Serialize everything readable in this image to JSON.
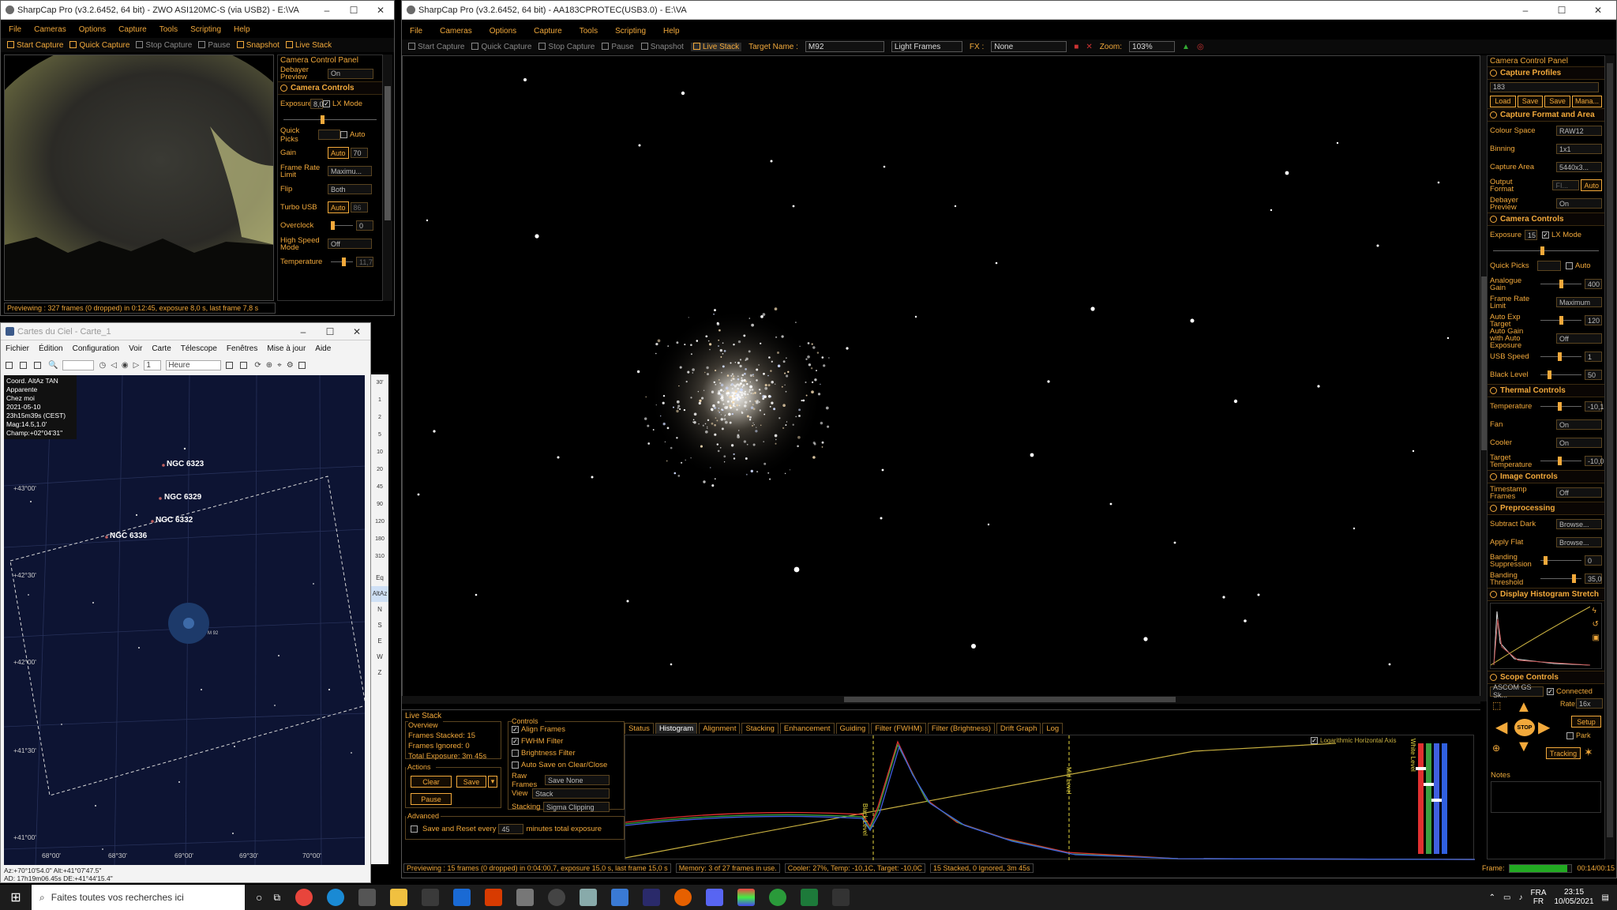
{
  "colors": {
    "accent": "#f2a93b",
    "sky": "#0d1433",
    "stars_bg": "#000000",
    "hist_red": "#e03030",
    "hist_green": "#3aa040",
    "hist_blue": "#4060e0",
    "hist_curve": "#c8b040"
  },
  "cam1": {
    "title": "SharpCap Pro (v3.2.6452, 64 bit) - ZWO ASI120MC-S (via USB2) - E:\\VA",
    "menu": [
      "File",
      "Cameras",
      "Options",
      "Capture",
      "Tools",
      "Scripting",
      "Help"
    ],
    "toolbar": [
      "Start Capture",
      "Quick Capture",
      "Stop Capture",
      "Pause",
      "Snapshot",
      "Live Stack"
    ],
    "panel_title": "Camera Control Panel",
    "debayer_label": "Debayer Preview",
    "debayer_value": "On",
    "controls_title": "Camera Controls",
    "exposure_label": "Exposure",
    "exposure_value": "8,0",
    "lx_label": "LX Mode",
    "quick_picks": "Quick Picks",
    "auto": "Auto",
    "rows": [
      {
        "label": "Gain",
        "value": "70",
        "auto": "Auto"
      },
      {
        "label": "Frame Rate Limit",
        "value": "Maximu..."
      },
      {
        "label": "Flip",
        "value": "Both"
      },
      {
        "label": "Turbo USB",
        "value": "86",
        "auto": "Auto"
      },
      {
        "label": "Overclock",
        "value": "0"
      },
      {
        "label": "High Speed Mode",
        "value": "Off"
      },
      {
        "label": "Temperature",
        "value": "11,7"
      }
    ],
    "status": "Previewing : 327 frames (0 dropped) in 0:12:45, exposure 8,0 s, last frame 7,8 s"
  },
  "cdc": {
    "title": "Cartes du Ciel - Carte_1",
    "menu": [
      "Fichier",
      "Édition",
      "Configuration",
      "Voir",
      "Carte",
      "Télescope",
      "Fenêtres",
      "Mise à jour",
      "Aide"
    ],
    "time_unit": "Heure",
    "step": "1",
    "info": [
      "Coord. AltAz TAN",
      "Apparente",
      "Chez moi",
      "2021-05-10",
      "23h15m39s (CEST)",
      "Mag:14.5,1.0'",
      "Champ:+02°04'31\""
    ],
    "objects": [
      "NGC 6323",
      "NGC 6329",
      "NGC 6332",
      "NGC 6336",
      "M 92"
    ],
    "dec_labels": [
      "+43°00'",
      "+42°30'",
      "+42°00'",
      "+41°30'",
      "+41°00'"
    ],
    "ra_labels": [
      "68°00'",
      "68°30'",
      "69°00'",
      "69°30'",
      "70°00'"
    ],
    "zoom_scale": [
      "30'",
      "1",
      "2",
      "5",
      "10",
      "20",
      "45",
      "90",
      "120",
      "180",
      "310"
    ],
    "side_labels": [
      "Eq",
      "AltAz",
      "N",
      "S",
      "E",
      "W",
      "Z"
    ],
    "status1": "Az:+70°10'54.0\" Alt:+41°07'47.5\"",
    "status2": "AD: 17h19m06.45s DE:+41°44'15.4\""
  },
  "cam2": {
    "title": "SharpCap Pro (v3.2.6452, 64 bit) - AA183CPROTEC(USB3.0) - E:\\VA",
    "menu": [
      "File",
      "Cameras",
      "Options",
      "Capture",
      "Tools",
      "Scripting",
      "Help"
    ],
    "toolbar": [
      "Start Capture",
      "Quick Capture",
      "Stop Capture",
      "Pause",
      "Snapshot",
      "Live Stack"
    ],
    "target_label": "Target Name :",
    "target_value": "M92",
    "frames_value": "Light Frames",
    "fx_label": "FX :",
    "fx_value": "None",
    "zoom_label": "Zoom:",
    "zoom_value": "103%",
    "livestack": {
      "title": "Live Stack",
      "overview": "Overview",
      "stats": [
        "Frames Stacked: 15",
        "Frames Ignored: 0",
        "Total Exposure: 3m 45s"
      ],
      "controls_title": "Controls",
      "checks": [
        {
          "label": "Align Frames",
          "on": true
        },
        {
          "label": "FWHM Filter",
          "on": true
        },
        {
          "label": "Brightness Filter",
          "on": false
        },
        {
          "label": "Auto Save on Clear/Close",
          "on": false
        }
      ],
      "actions_title": "Actions",
      "clear": "Clear",
      "save": "Save",
      "pause": "Pause",
      "raw_label": "Raw Frames",
      "raw_value": "Save None",
      "view_label": "View",
      "view_value": "Stack",
      "stacking_label": "Stacking",
      "stacking_value": "Sigma Clipping",
      "advanced_title": "Advanced",
      "save_reset_label": "Save and Reset every",
      "save_reset_value": "45",
      "save_reset_unit": "minutes total exposure",
      "tabs": [
        "Status",
        "Histogram",
        "Alignment",
        "Stacking",
        "Enhancement",
        "Guiding",
        "Filter (FWHM)",
        "Filter (Brightness)",
        "Drift Graph",
        "Log"
      ],
      "active_tab": "Histogram",
      "log_axis": "Logarithmic Horizontal Axis",
      "black_level": "Black Level",
      "mid_level": "Mid Level",
      "white_level": "White Level"
    },
    "status": [
      "Previewing : 15 frames (0 dropped) in 0:04:00,7, exposure 15,0 s, last frame 15,0 s",
      "Memory: 3 of 27 frames in use.",
      "Cooler: 27%, Temp: -10,1C, Target: -10,0C",
      "15 Stacked, 0 Ignored, 3m 45s"
    ],
    "frame_label": "Frame:",
    "frame_time": "00:14/00:15"
  },
  "ccp": {
    "title": "Camera Control Panel",
    "profiles_title": "Capture Profiles",
    "profile_value": "183",
    "profile_buttons": [
      "Load",
      "Save",
      "Save",
      "Mana..."
    ],
    "format_title": "Capture Format and Area",
    "format_rows": [
      {
        "label": "Colour Space",
        "value": "RAW12"
      },
      {
        "label": "Binning",
        "value": "1x1"
      },
      {
        "label": "Capture Area",
        "value": "5440x3..."
      },
      {
        "label": "Output Format",
        "value": "FI...",
        "auto": "Auto"
      },
      {
        "label": "Debayer Preview",
        "value": "On"
      }
    ],
    "controls_title": "Camera Controls",
    "exposure_label": "Exposure",
    "exposure_value": "15",
    "lx_label": "LX Mode",
    "quick_picks": "Quick Picks",
    "auto": "Auto",
    "control_rows": [
      {
        "label": "Analogue Gain",
        "value": "400",
        "slider": 0.55
      },
      {
        "label": "Frame Rate Limit",
        "value": "Maximum"
      },
      {
        "label": "Auto Exp Target",
        "value": "120",
        "slider": 0.55
      },
      {
        "label": "Auto Gain with Auto Exposure",
        "value": "Off"
      },
      {
        "label": "USB Speed",
        "value": "1",
        "slider": 0.5
      },
      {
        "label": "Black Level",
        "value": "50",
        "slider": 0.2
      }
    ],
    "thermal_title": "Thermal Controls",
    "thermal_rows": [
      {
        "label": "Temperature",
        "value": "-10,1",
        "slider": 0.5
      },
      {
        "label": "Fan",
        "value": "On"
      },
      {
        "label": "Cooler",
        "value": "On"
      },
      {
        "label": "Target Temperature",
        "value": "-10,0",
        "slider": 0.5
      }
    ],
    "image_title": "Image Controls",
    "image_rows": [
      {
        "label": "Timestamp Frames",
        "value": "Off"
      }
    ],
    "pre_title": "Preprocessing",
    "pre_rows": [
      {
        "label": "Subtract Dark",
        "value": "Browse..."
      },
      {
        "label": "Apply Flat",
        "value": "Browse..."
      },
      {
        "label": "Banding Suppression",
        "value": "0",
        "slider": 0.1
      },
      {
        "label": "Banding Threshold",
        "value": "35,0",
        "slider": 0.9
      }
    ],
    "hist_title": "Display Histogram Stretch",
    "scope_title": "Scope Controls",
    "scope_value": "ASCOM GS Sk...",
    "connected": "Connected",
    "rate_label": "Rate:",
    "rate_value": "16x",
    "setup": "Setup",
    "park": "Park",
    "tracking": "Tracking",
    "stop": "STOP",
    "notes": "Notes"
  },
  "taskbar": {
    "search": "Faites toutes vos recherches ici",
    "lang1": "FRA",
    "lang2": "FR",
    "time": "23:15",
    "date": "10/05/2021"
  }
}
